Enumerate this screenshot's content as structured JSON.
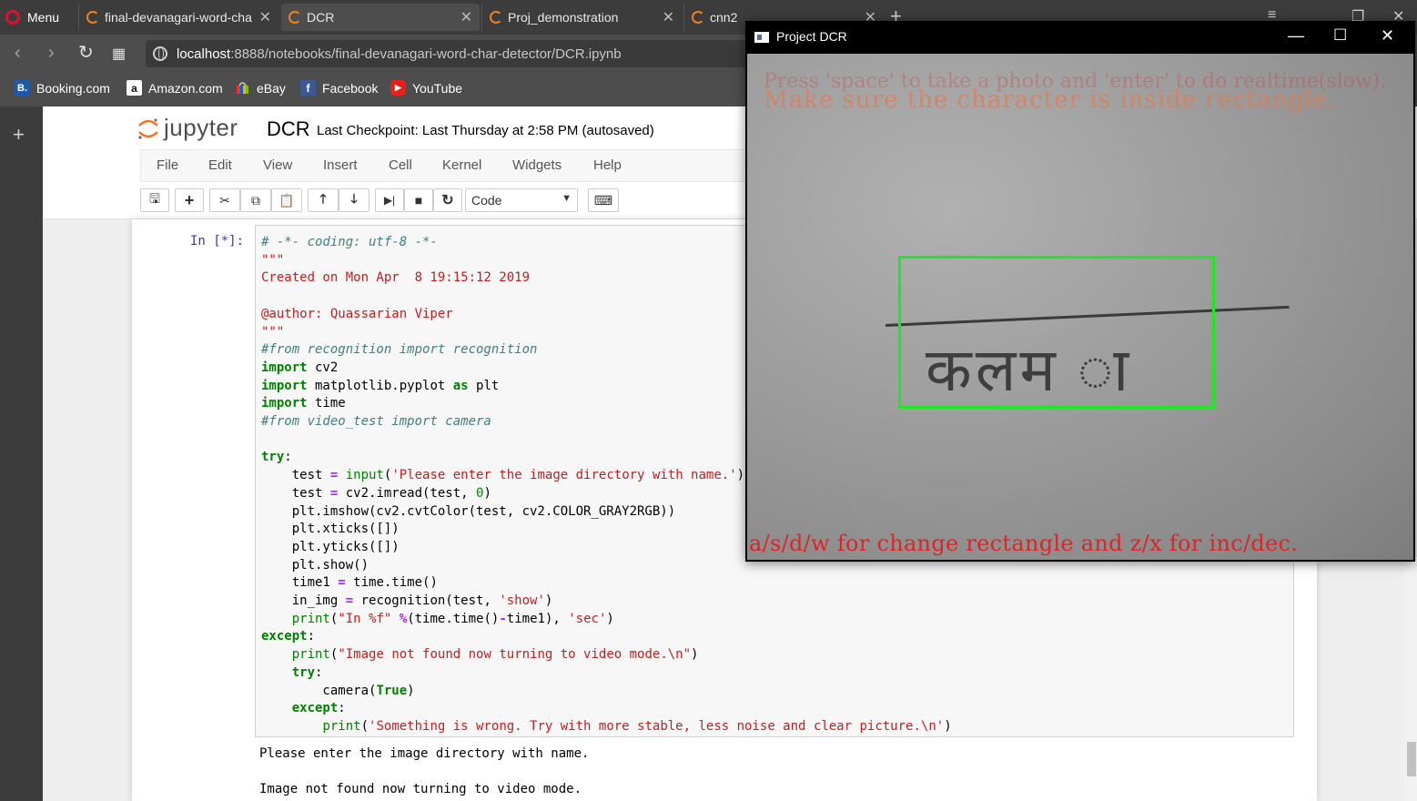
{
  "browser": {
    "menu_label": "Menu",
    "tabs": [
      {
        "title": "final-devanagari-word-cha"
      },
      {
        "title": "DCR"
      },
      {
        "title": "Proj_demonstration"
      },
      {
        "title": "cnn2"
      }
    ],
    "url_host": "localhost",
    "url_path": ":8888/notebooks/final-devanagari-word-char-detector/DCR.ipynb",
    "bookmarks": [
      {
        "label": "Booking.com",
        "icon": "B."
      },
      {
        "label": "Amazon.com",
        "icon": "a"
      },
      {
        "label": "eBay",
        "icon": ""
      },
      {
        "label": "Facebook",
        "icon": "f"
      },
      {
        "label": "YouTube",
        "icon": "▶"
      }
    ]
  },
  "jupyter": {
    "logo_text": "jupyter",
    "notebook_name": "DCR",
    "checkpoint": "Last Checkpoint: Last Thursday at 2:58 PM (autosaved)",
    "menu": [
      "File",
      "Edit",
      "View",
      "Insert",
      "Cell",
      "Kernel",
      "Widgets",
      "Help"
    ],
    "cell_type": "Code",
    "cell_prompt": "In [*]:",
    "output_lines": [
      "Please enter the image directory with name.",
      "",
      "Image not found now turning to video mode."
    ]
  },
  "cv_window": {
    "title": "Project DCR",
    "line1": "Press 'space' to take a photo and 'enter' to do realtime(slow).",
    "line2": "Make sure the character is inside rectangle.",
    "line3": "a/s/d/w for change rectangle and z/x for inc/dec.",
    "handwriting": "कलम",
    "handwriting_tail": "ा"
  },
  "colors": {
    "rect": "#1ee81e",
    "cv_text": "#e02424",
    "opera": "#e0102d",
    "jupyter_orange": "#f37626"
  }
}
